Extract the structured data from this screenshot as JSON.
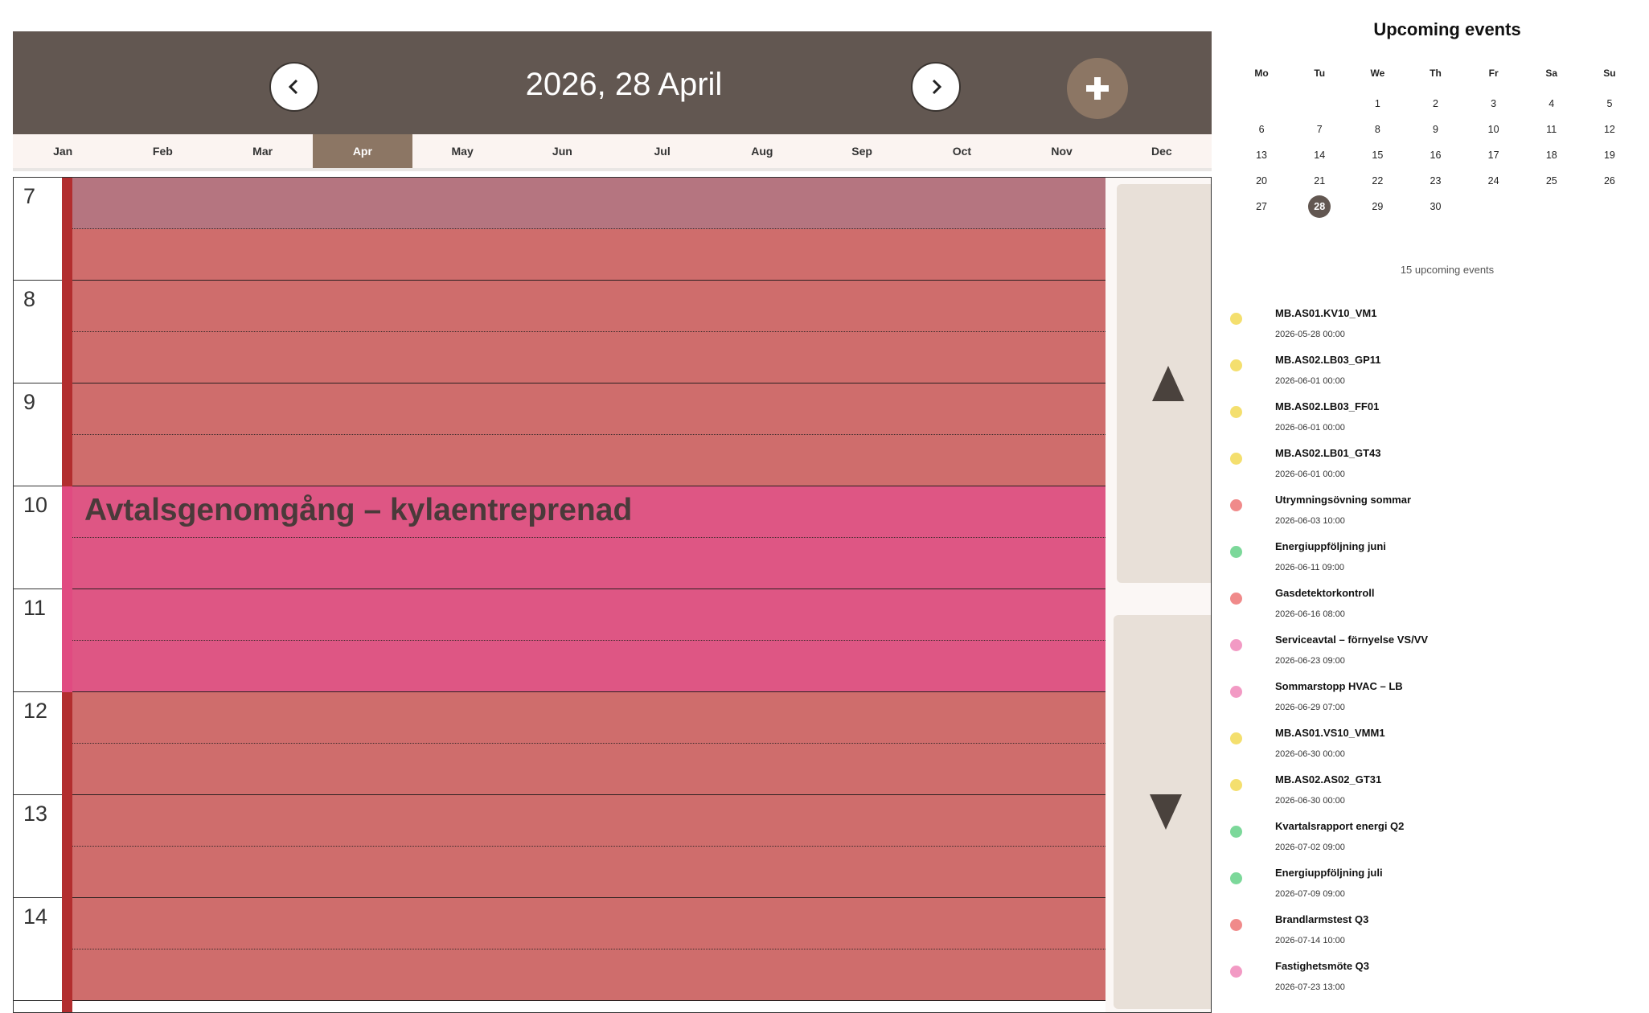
{
  "header": {
    "title": "2026, 28 April",
    "background": "#625751",
    "add_button_color": "#8c7664"
  },
  "months": [
    "Jan",
    "Feb",
    "Mar",
    "Apr",
    "May",
    "Jun",
    "Jul",
    "Aug",
    "Sep",
    "Oct",
    "Nov",
    "Dec"
  ],
  "active_month": "Apr",
  "schedule": {
    "hours": [
      "7",
      "8",
      "9",
      "10",
      "11",
      "12",
      "13",
      "14"
    ],
    "event_title": "Avtalsgenomgång – kylaentreprenad",
    "colors": {
      "background_slot": "#cf6d6c",
      "first_slot": "#b57580",
      "event": "#de5684",
      "stripe": "#b22e2f"
    }
  },
  "scroll": {
    "up_icon": "triangle-up-icon",
    "down_icon": "triangle-down-icon"
  },
  "right_panel": {
    "title": "Upcoming events",
    "weekdays": [
      "Mo",
      "Tu",
      "We",
      "Th",
      "Fr",
      "Sa",
      "Su"
    ],
    "weeks": [
      [
        "",
        "",
        "1",
        "2",
        "3",
        "4",
        "5"
      ],
      [
        "6",
        "7",
        "8",
        "9",
        "10",
        "11",
        "12"
      ],
      [
        "13",
        "14",
        "15",
        "16",
        "17",
        "18",
        "19"
      ],
      [
        "20",
        "21",
        "22",
        "23",
        "24",
        "25",
        "26"
      ],
      [
        "27",
        "28",
        "29",
        "30",
        "",
        "",
        ""
      ]
    ],
    "today": "28",
    "upcoming_count": "15 upcoming events",
    "events": [
      {
        "name": "MB.AS01.KV10_VM1",
        "date": "2026-05-28 00:00",
        "color": "#f4df6e"
      },
      {
        "name": "MB.AS02.LB03_GP11",
        "date": "2026-06-01 00:00",
        "color": "#f4df6e"
      },
      {
        "name": "MB.AS02.LB03_FF01",
        "date": "2026-06-01 00:00",
        "color": "#f4df6e"
      },
      {
        "name": "MB.AS02.LB01_GT43",
        "date": "2026-06-01 00:00",
        "color": "#f4df6e"
      },
      {
        "name": "Utrymningsövning sommar",
        "date": "2026-06-03 10:00",
        "color": "#f08a8a"
      },
      {
        "name": "Energiuppföljning juni",
        "date": "2026-06-11 09:00",
        "color": "#7cd89a"
      },
      {
        "name": "Gasdetektorkontroll",
        "date": "2026-06-16 08:00",
        "color": "#f08a8a"
      },
      {
        "name": "Serviceavtal – förnyelse VS/VV",
        "date": "2026-06-23 09:00",
        "color": "#f29ac4"
      },
      {
        "name": "Sommarstopp HVAC – LB",
        "date": "2026-06-29 07:00",
        "color": "#f29ac4"
      },
      {
        "name": "MB.AS01.VS10_VMM1",
        "date": "2026-06-30 00:00",
        "color": "#f4df6e"
      },
      {
        "name": "MB.AS02.AS02_GT31",
        "date": "2026-06-30 00:00",
        "color": "#f4df6e"
      },
      {
        "name": "Kvartalsrapport energi Q2",
        "date": "2026-07-02 09:00",
        "color": "#7cd89a"
      },
      {
        "name": "Energiuppföljning juli",
        "date": "2026-07-09 09:00",
        "color": "#7cd89a"
      },
      {
        "name": "Brandlarmstest Q3",
        "date": "2026-07-14 10:00",
        "color": "#f08a8a"
      },
      {
        "name": "Fastighetsmöte Q3",
        "date": "2026-07-23 13:00",
        "color": "#f29ac4"
      }
    ]
  }
}
